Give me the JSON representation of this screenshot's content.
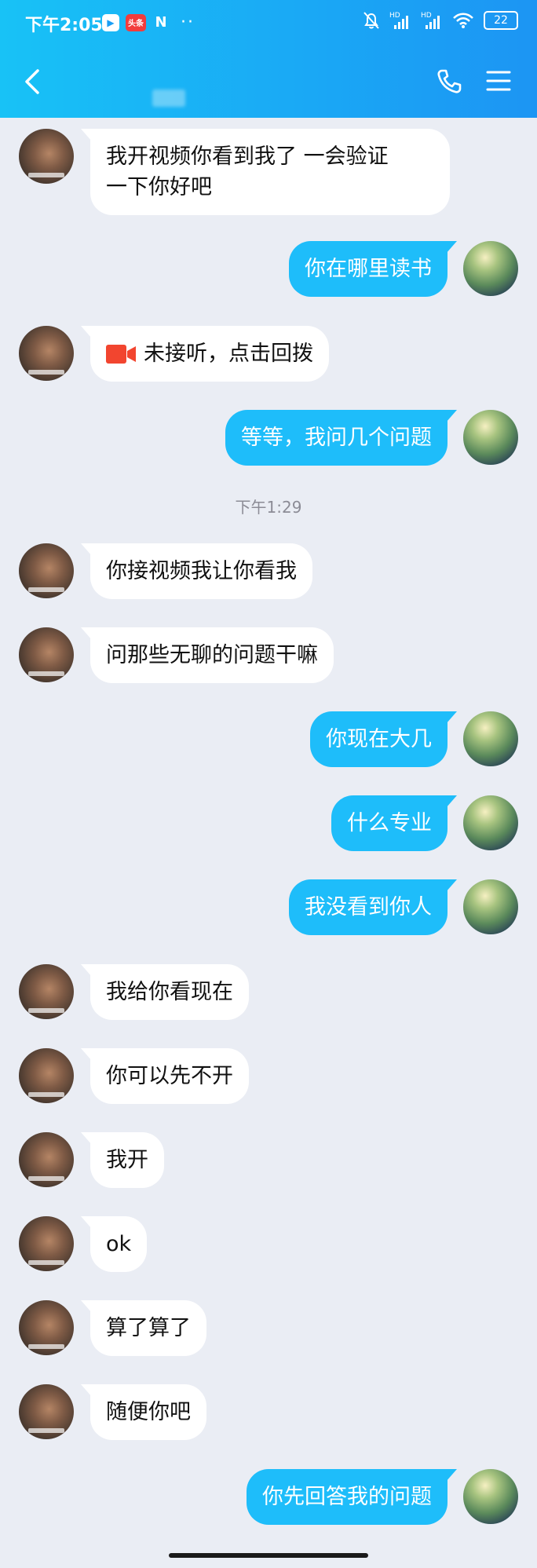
{
  "status_bar": {
    "time": "下午2:05",
    "app_badges": [
      "play",
      "头条",
      "N"
    ],
    "more": "··",
    "signal_labels": [
      "HD",
      "HD"
    ],
    "battery": "22"
  },
  "nav": {
    "back_icon": "chevron-left-icon",
    "call_icon": "phone-icon",
    "menu_icon": "menu-icon"
  },
  "messages": [
    {
      "side": "in",
      "text": "我开视频你看到我了 一会验证\n一下你好吧"
    },
    {
      "side": "out",
      "text": "你在哪里读书"
    },
    {
      "side": "in",
      "type": "missed",
      "text": "未接听，点击回拨"
    },
    {
      "side": "out",
      "text": "等等，我问几个问题"
    },
    {
      "type": "time",
      "text": "下午1:29"
    },
    {
      "side": "in",
      "text": "你接视频我让你看我"
    },
    {
      "side": "in",
      "text": "问那些无聊的问题干嘛"
    },
    {
      "side": "out",
      "text": "你现在大几"
    },
    {
      "side": "out",
      "text": "什么专业"
    },
    {
      "side": "out",
      "text": "我没看到你人"
    },
    {
      "side": "in",
      "text": "我给你看现在"
    },
    {
      "side": "in",
      "text": "你可以先不开"
    },
    {
      "side": "in",
      "text": "我开"
    },
    {
      "side": "in",
      "text": "ok"
    },
    {
      "side": "in",
      "text": "算了算了"
    },
    {
      "side": "in",
      "text": "随便你吧"
    },
    {
      "side": "out",
      "text": "你先回答我的问题"
    }
  ],
  "colors": {
    "header_start": "#18c2f6",
    "header_end": "#1c95f3",
    "outgoing_bubble": "#1ebdfa",
    "incoming_bubble": "#ffffff",
    "missed_call": "#f2452f",
    "background": "#eaedf4"
  }
}
